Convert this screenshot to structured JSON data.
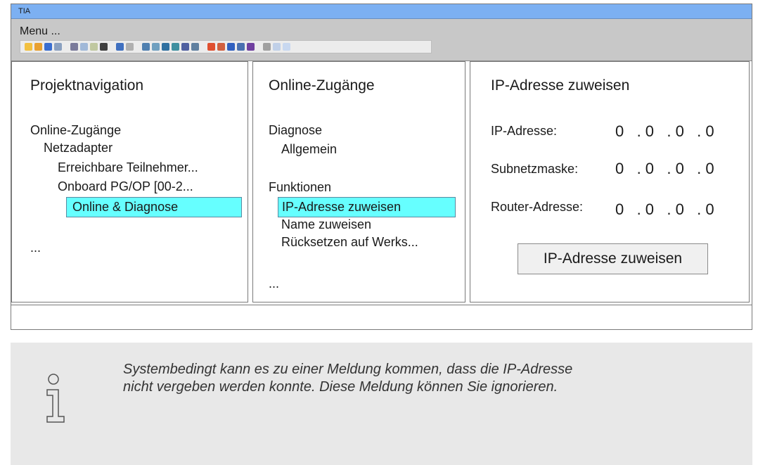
{
  "window": {
    "title": "TIA",
    "menu_label": "Menu ...",
    "toolbar_icons": [
      {
        "name": "new-project-icon",
        "color": "#f2c040"
      },
      {
        "name": "open-project-icon",
        "color": "#e8a030"
      },
      {
        "name": "save-icon",
        "color": "#3a6ed0"
      },
      {
        "name": "print-icon",
        "color": "#8aa0c0"
      },
      {
        "name": "cut-icon",
        "color": "#7a7a9a"
      },
      {
        "name": "copy-icon",
        "color": "#a0b8d8"
      },
      {
        "name": "paste-icon",
        "color": "#c0c8a0"
      },
      {
        "name": "delete-icon",
        "color": "#404040"
      },
      {
        "name": "undo-icon",
        "color": "#4070c0"
      },
      {
        "name": "redo-icon",
        "color": "#b0b0b0"
      },
      {
        "name": "compile-icon",
        "color": "#5080b0"
      },
      {
        "name": "download-icon",
        "color": "#70a0c0"
      },
      {
        "name": "upload-icon",
        "color": "#3070a0"
      },
      {
        "name": "go-online-icon",
        "color": "#4090a0"
      },
      {
        "name": "go-offline-icon",
        "color": "#5060a0"
      },
      {
        "name": "accessible-devices-icon",
        "color": "#6080a0"
      },
      {
        "name": "start-cpu-icon",
        "color": "#e05030"
      },
      {
        "name": "stop-cpu-icon",
        "color": "#d06040"
      },
      {
        "name": "cross-reference-icon",
        "color": "#3060c0"
      },
      {
        "name": "split-editor-icon",
        "color": "#4a70b0"
      },
      {
        "name": "monitor-icon",
        "color": "#7040a0"
      },
      {
        "name": "close-icon",
        "color": "#a0a0a0"
      },
      {
        "name": "split-horizontal-icon",
        "color": "#c0d0e8"
      },
      {
        "name": "split-vertical-icon",
        "color": "#c8d8f0"
      }
    ]
  },
  "project_nav": {
    "title": "Projektnavigation",
    "items": [
      "Online-Zugänge",
      "Netzadapter",
      "Erreichbare Teilnehmer...",
      "Onboard PG/OP [00-2..."
    ],
    "selected": "Online & Diagnose",
    "more": "..."
  },
  "online_access": {
    "title": "Online-Zugänge",
    "diagnose": "Diagnose",
    "allgemein": "Allgemein",
    "funktionen": "Funktionen",
    "selected": "IP-Adresse zuweisen",
    "name_zuweisen": "Name zuweisen",
    "ruecksetzen": "Rücksetzen auf Werks...",
    "more": "..."
  },
  "ip_assign": {
    "title": "IP-Adresse zuweisen",
    "rows": [
      {
        "label": "IP-Adresse:",
        "value": "0   . 0   . 0   . 0"
      },
      {
        "label": "Subnetzmaske:",
        "value": "0   . 0   . 0   . 0"
      },
      {
        "label": "Router-Adresse:",
        "value": "0   . 0   . 0   . 0"
      }
    ],
    "button": "IP-Adresse zuweisen"
  },
  "note": {
    "line1": "Systembedingt kann es zu einer Meldung kommen, dass die IP-Adresse",
    "line2": "nicht vergeben werden konnte. Diese Meldung können Sie ignorieren."
  }
}
